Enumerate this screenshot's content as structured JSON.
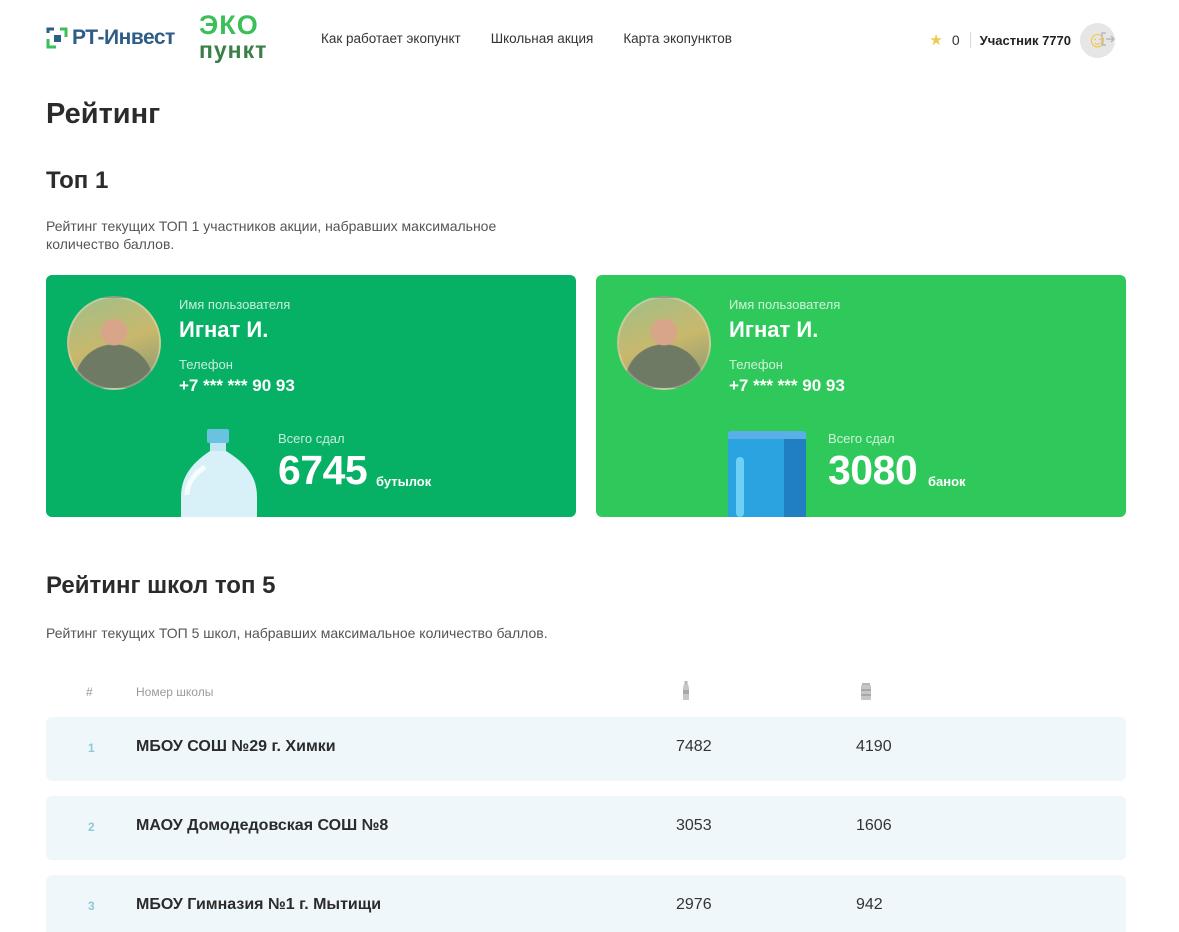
{
  "header": {
    "brand": "РТ-Инвест",
    "eko_line1": "ЭКО",
    "eko_line2": "пункт",
    "nav": [
      "Как работает экопункт",
      "Школьная акция",
      "Карта экопунктов"
    ],
    "score": "0",
    "username": "Участник 7770"
  },
  "page": {
    "title": "Рейтинг",
    "top_title": "Топ 1",
    "top_desc": "Рейтинг текущих ТОП 1 участников акции, набравших максимальное количество баллов.",
    "schools_title": "Рейтинг школ топ 5",
    "schools_desc": "Рейтинг текущих ТОП 5 школ, набравших максимальное количество баллов."
  },
  "cards": [
    {
      "name_label": "Имя пользователя",
      "name": "Игнат И.",
      "phone_label": "Телефон",
      "phone": "+7 *** *** 90 93",
      "total_label": "Всего сдал",
      "total": "6745",
      "unit": "бутылок",
      "icon": "water-bottle-icon",
      "color": "#06b064"
    },
    {
      "name_label": "Имя пользователя",
      "name": "Игнат И.",
      "phone_label": "Телефон",
      "phone": "+7 *** *** 90 93",
      "total_label": "Всего сдал",
      "total": "3080",
      "unit": "банок",
      "icon": "can-icon",
      "color": "#2ec95a"
    }
  ],
  "table": {
    "headers": {
      "rank": "#",
      "school": "Номер школы",
      "col1_icon": "bottle-icon",
      "col2_icon": "can-icon"
    },
    "rows": [
      {
        "rank": "1",
        "school": "МБОУ СОШ №29 г. Химки",
        "bottles": "7482",
        "cans": "4190"
      },
      {
        "rank": "2",
        "school": "МАОУ Домодедовская СОШ №8",
        "bottles": "3053",
        "cans": "1606"
      },
      {
        "rank": "3",
        "school": "МБОУ Гимназия №1 г. Мытищи",
        "bottles": "2976",
        "cans": "942"
      }
    ]
  }
}
